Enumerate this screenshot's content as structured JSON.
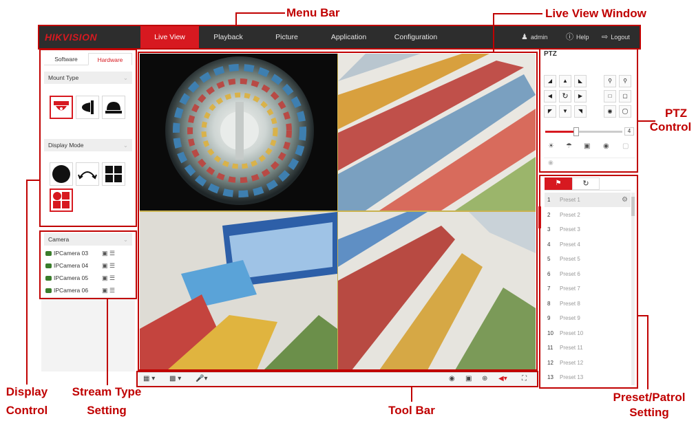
{
  "annotations": {
    "menu_bar": "Menu Bar",
    "live_view_window": "Live View Window",
    "ptz_control_line1": "PTZ",
    "ptz_control_line2": "Control",
    "display_control_line1": "Display",
    "display_control_line2": "Control",
    "stream_type_line1": "Stream Type",
    "stream_type_line2": "Setting",
    "tool_bar": "Tool Bar",
    "preset_patrol_line1": "Preset/Patrol",
    "preset_patrol_line2": "Setting"
  },
  "header": {
    "logo": "HIKVISION",
    "menu": [
      "Live View",
      "Playback",
      "Picture",
      "Application",
      "Configuration"
    ],
    "active_menu": "Live View",
    "user": "admin",
    "help": "Help",
    "logout": "Logout"
  },
  "display_control": {
    "tabs": [
      "Software",
      "Hardware"
    ],
    "active_tab": "Hardware",
    "mount_type": "Mount Type",
    "mount_icons": [
      "ceiling-mount-icon",
      "wall-mount-icon",
      "desktop-mount-icon"
    ],
    "display_mode": "Display Mode",
    "display_icons": [
      "fisheye-icon",
      "panorama-icon",
      "quad-view-icon",
      "fisheye-plus-three-ptz-icon"
    ]
  },
  "camera_panel": {
    "header": "Camera",
    "cameras": [
      "IPCamera 03",
      "IPCamera 04",
      "IPCamera 05",
      "IPCamera 06"
    ]
  },
  "ptz": {
    "title": "PTZ",
    "speed": "4",
    "speed_fraction": 0.4
  },
  "preset": {
    "tabs": [
      "flag-icon",
      "patrol-icon"
    ],
    "items": [
      {
        "num": "1",
        "name": "Preset 1"
      },
      {
        "num": "2",
        "name": "Preset 2"
      },
      {
        "num": "3",
        "name": "Preset 3"
      },
      {
        "num": "4",
        "name": "Preset 4"
      },
      {
        "num": "5",
        "name": "Preset 5"
      },
      {
        "num": "6",
        "name": "Preset 6"
      },
      {
        "num": "7",
        "name": "Preset 7"
      },
      {
        "num": "8",
        "name": "Preset 8"
      },
      {
        "num": "9",
        "name": "Preset 9"
      },
      {
        "num": "10",
        "name": "Preset 10"
      },
      {
        "num": "11",
        "name": "Preset 11"
      },
      {
        "num": "12",
        "name": "Preset 12"
      },
      {
        "num": "13",
        "name": "Preset 13"
      }
    ]
  },
  "colors": {
    "brand_red": "#d71920",
    "annotation_red": "#c00000",
    "menu_bg": "#2d2d2d"
  }
}
